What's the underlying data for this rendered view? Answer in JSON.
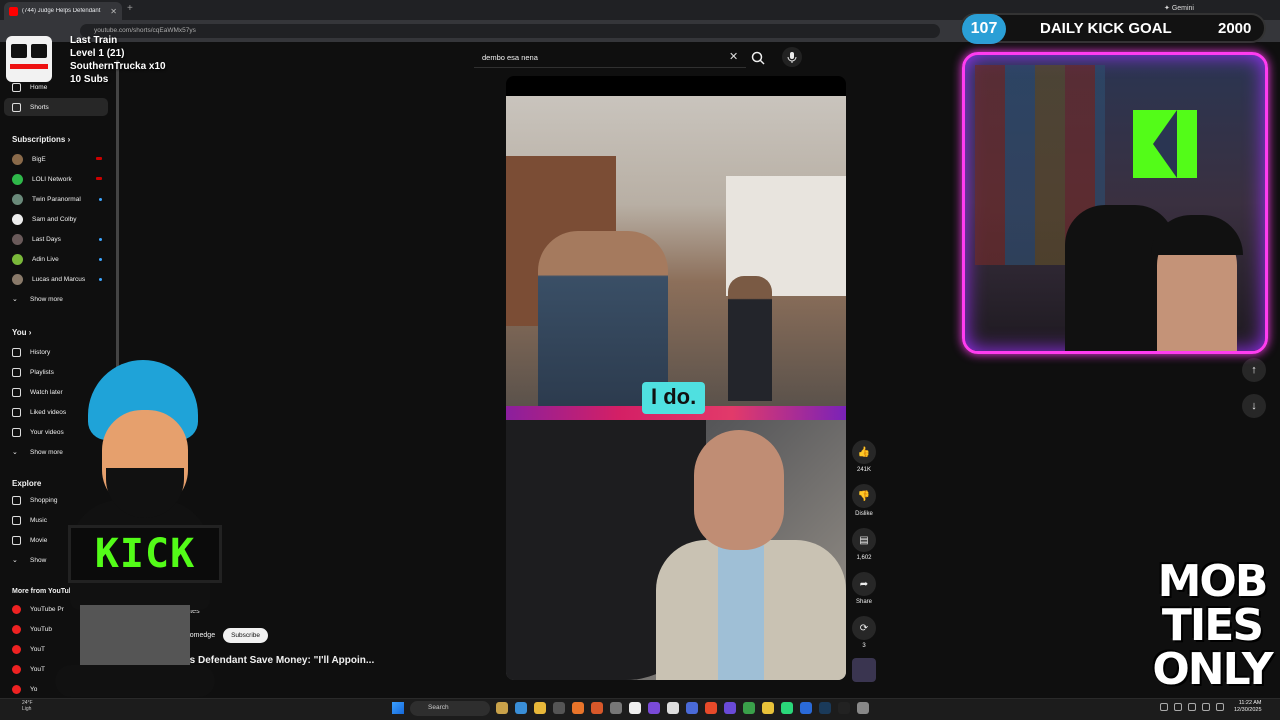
{
  "browser": {
    "tab_title": "(744) Judge Helps Defendant",
    "url": "youtube.com/shorts/cqEaWMx57ys",
    "gemini_label": "Gemini"
  },
  "search": {
    "query": "dembo esa nena"
  },
  "sidebar": {
    "top_items": [
      {
        "label": "Home",
        "icon": "home-icon"
      },
      {
        "label": "Shorts",
        "icon": "shorts-icon",
        "active": true
      }
    ],
    "subscriptions_heading": "Subscriptions",
    "subscriptions": [
      {
        "label": "BigE",
        "indicator": "live"
      },
      {
        "label": "LOLI Network",
        "indicator": "live"
      },
      {
        "label": "Twin Paranormal",
        "indicator": "dot"
      },
      {
        "label": "Sam and Colby",
        "indicator": "none"
      },
      {
        "label": "Last Days",
        "indicator": "dot"
      },
      {
        "label": "Adin Live",
        "indicator": "dot"
      },
      {
        "label": "Lucas and Marcus",
        "indicator": "dot"
      }
    ],
    "show_more": "Show more",
    "you_heading": "You",
    "you_items": [
      {
        "label": "History",
        "icon": "history-icon"
      },
      {
        "label": "Playlists",
        "icon": "playlists-icon"
      },
      {
        "label": "Watch later",
        "icon": "watch-later-icon"
      },
      {
        "label": "Liked videos",
        "icon": "like-icon"
      },
      {
        "label": "Your videos",
        "icon": "video-icon"
      },
      {
        "label": "Show more",
        "icon": "chevron-down-icon"
      }
    ],
    "explore_heading": "Explore",
    "explore_items": [
      {
        "label": "Shopping",
        "icon": "bag-icon"
      },
      {
        "label": "Music",
        "icon": "music-icon"
      },
      {
        "label": "Movie",
        "icon": "movie-icon"
      },
      {
        "label": "Show",
        "icon": "chevron-down-icon"
      }
    ],
    "more_heading": "More from YouTub",
    "more_items": [
      "YouTube Pr",
      "YouTub",
      "YouT",
      "YouT",
      "Yo"
    ]
  },
  "video": {
    "caption": "I do.",
    "channel": "courtroomedge",
    "subscribe_label": "Subscribe",
    "title": "Helps Defendant Save Money: \"I'll Appoin...",
    "country": "ed States"
  },
  "actions": {
    "likes": "241K",
    "dislike_label": "Dislike",
    "comments": "1,602",
    "share_label": "Share",
    "remix_count": "3"
  },
  "overlay": {
    "train_name": "Last Train",
    "level": "Level 1  (21)",
    "gifter": "SouthernTrucka x10",
    "subs": "10 Subs",
    "kick_sign": "KICK",
    "goal_current": "107",
    "goal_label": "DAILY KICK GOAL",
    "goal_target": "2000",
    "goal_progress": 0.0535,
    "mob_lines": [
      "MOB",
      "TIES",
      "ONLY"
    ]
  },
  "taskbar": {
    "search_label": "Search",
    "weather": "24°F",
    "weather_sub": "Ligh",
    "time": "11:22 AM",
    "date": "12/30/2025"
  },
  "colors": {
    "kick_green": "#53fc18",
    "neon_pink": "#ff3cf0",
    "goal_blue": "#2a9fd6"
  }
}
